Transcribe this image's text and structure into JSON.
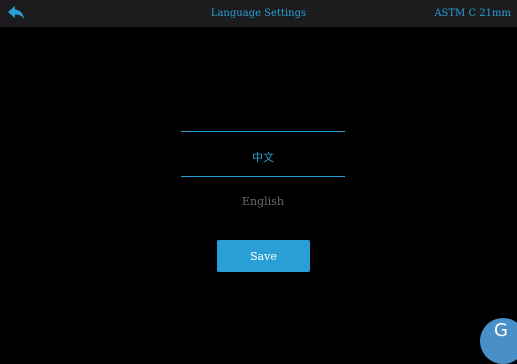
{
  "header": {
    "title": "Language Settings",
    "right_text": "ASTM C 21mm",
    "back_icon": "back-arrow-icon"
  },
  "languages": {
    "selected": "中文",
    "other": "English"
  },
  "save_label": "Save",
  "floating_button": {
    "label": "G"
  },
  "colors": {
    "background": "#000000",
    "header": "#1c1c1e",
    "accent": "#2a9fd6",
    "inactive_text": "#6a6a6a"
  }
}
